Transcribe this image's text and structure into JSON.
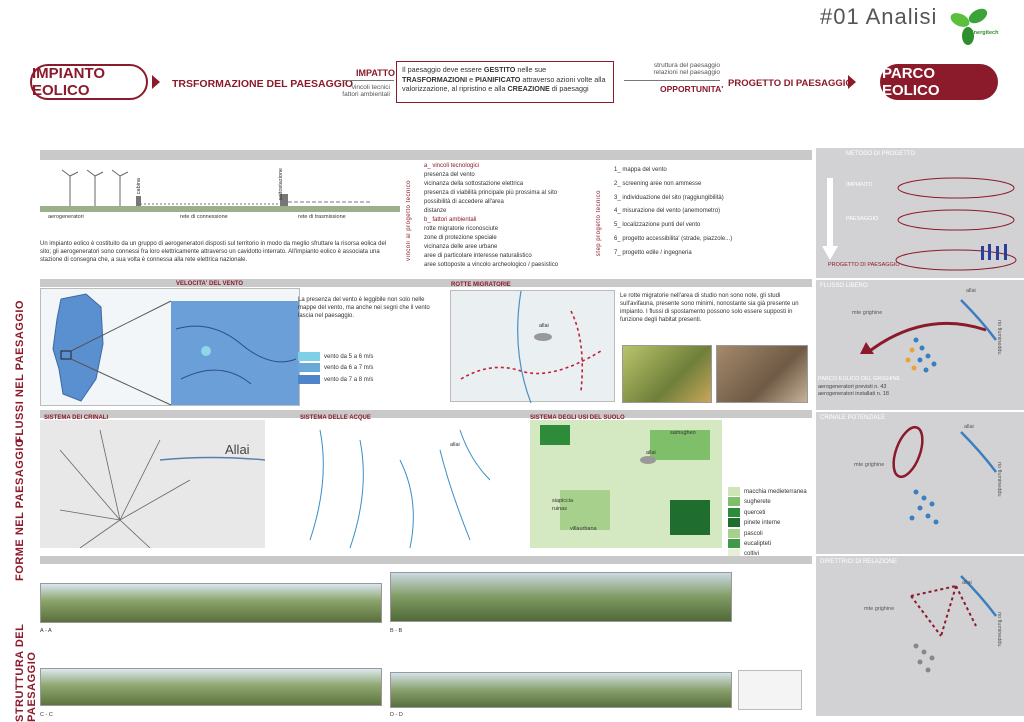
{
  "header": {
    "title": "#01 Analisi",
    "logo_text": "Energitech",
    "impianto": "IMPIANTO EOLICO",
    "trasformazione": "TRSFORMAZIONE DEL PAESAGGIO",
    "impatto": "IMPATTO",
    "impatto_sub": "vincoli tecnici\nfattori ambientali",
    "central_text_1": "Il paesaggio deve essere ",
    "central_b1": "GESTITO",
    "central_text_2": " nelle sue ",
    "central_b2": "TRASFORMAZIONI",
    "central_text_3": " e ",
    "central_b3": "PIANIFICATO",
    "central_text_4": " attraverso azioni volte alla valorizzazione, al ripristino e alla ",
    "central_b4": "CREAZIONE",
    "central_text_5": " di paesaggi",
    "opportunita_sub": "struttura del paesaggio\nrelazioni nel paesaggio",
    "opportunita": "OPPORTUNITA'",
    "progetto": "PROGETTO DI PAESAGGIO",
    "parco": "PARCO EOLICO"
  },
  "section1": {
    "label_aero": "aerogeneratori",
    "label_rete_conn": "rete di connessione",
    "label_rete_tras": "rete di trasmissione",
    "label_cabina": "cabina",
    "label_sotto": "sottostazione",
    "desc": "Un impianto eolico è costituito da un gruppo di aerogeneratori disposti sul territorio in modo da meglio sfruttare la risorsa eolica del sito; gli aerogeneratori sono connessi fra loro elettricamente attraverso un cavidotto interrato. All'impianto eolico è associata una stazione di consegna che, a sua volta è connessa alla rete elettrica nazionale.",
    "vincoli_side": "vincoli al progetto tecnico",
    "vincoli": [
      "a_ vincoli tecnologici",
      "presenza del vento",
      "vicinanza della sottostazione elettrica",
      "presenza di viabilità principale più prossima al sito",
      "possibilità di accedere all'area",
      "distanze",
      "b_ fattori ambientali",
      "rotte migratorie riconosciute",
      "zone di protezione speciale",
      "vicinanza delle aree urbane",
      "aree di particolare interesse naturalistico",
      "aree sottoposte a vincolo archeologico / paesistico"
    ],
    "step_side": "step progetto tecnico",
    "steps": [
      "1_ mappa del vento",
      "2_ screening aree non ammesse",
      "3_ individuazione del sito (raggiungibilità)",
      "4_ misurazione del vento (anemometro)",
      "5_ localizzazione punti del vento",
      "6_ progetto accessibilita' (strade, piazzole...)",
      "7_ progetto edile / ingegneria"
    ]
  },
  "flussi": {
    "side": "FLUSSI NEL PAESAGGIO",
    "vento_title": "VELOCITA' DEL VENTO",
    "vento_text": "La presenza del vento è leggibile non solo nelle mappe del vento, ma anche nei segni che il vento lascia nel paesaggio.",
    "legend": [
      "vento da 5 a 6 m/s",
      "vento da 6 a 7 m/s",
      "vento da 7 a 8 m/s"
    ],
    "legend_colors": [
      "#7fd0e6",
      "#6aa8d8",
      "#4f84c9"
    ],
    "rotte_title": "ROTTE MIGRATORIE",
    "rotte_text": "Le rotte migratorie nell'area di studio non sono note, gli studi sull'avifauna, presente sono minimi, nonostante sia già presente un impianto. I flussi di spostamento possono solo essere supposti in funzione degli habitat presenti.",
    "allai": "allai"
  },
  "forme": {
    "side": "FORME NEL PAESAGGIO",
    "crinali": "SISTEMA DEI CRINALI",
    "acque": "SISTEMA DELLE ACQUE",
    "usi": "SISTEMA DEGLI USI DEL SUOLO",
    "allai_big": "Allai",
    "allai_small": "allai",
    "samugheo": "samugheo",
    "siapiccia": "siapiccia",
    "ruinas": "ruinas",
    "villaurbana": "villaurbana",
    "usi_legend": [
      "macchia medieterranea",
      "sugherete",
      "querceti",
      "pinete interne",
      "pascoli",
      "eucalipteti",
      "coltivi"
    ],
    "usi_colors": [
      "#cfe5b8",
      "#7fbf6a",
      "#2e8b3a",
      "#1f6e30",
      "#a8d08d",
      "#3e9a4a",
      "#e6f0d8"
    ]
  },
  "struttura": {
    "side": "STRUTTURA DEL PAESAGGIO",
    "sections": [
      "A - A",
      "B - B",
      "C - C",
      "D - D"
    ]
  },
  "right": {
    "metodo": "METODO DI PROGETTO",
    "impianto": "IMPIANTO",
    "paesaggio": "PAESAGGIO",
    "progetto": "PROGETTO DI PAESAGGIO",
    "flusso": "FLUSSO LIBERO",
    "mte": "mte grighine",
    "rio": "rio flumineddu",
    "allai": "allai",
    "parco_title": "PARCO EOLICO DEL GRIGHINE",
    "previsti": "aerogeneratori previsti n. 43",
    "installati": "aerogeneratori installati n. 18",
    "crinale": "CRINALE POTENZIALE",
    "direttrici": "DIRETTRICI DI RELAZIONE"
  }
}
